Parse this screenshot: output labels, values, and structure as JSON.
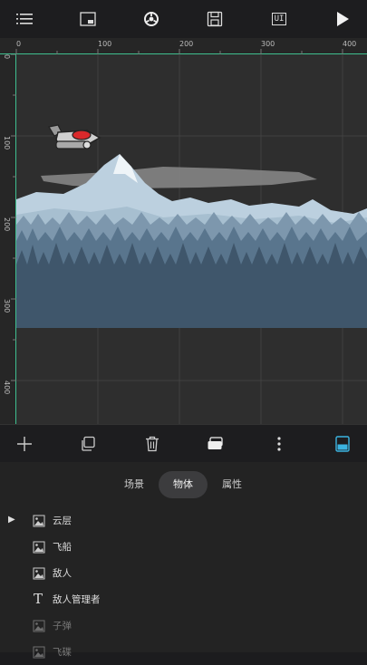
{
  "toolbar": {
    "menu_icon": "hamburger-menu",
    "layers_icon": "window",
    "settings_icon": "gear",
    "save_icon": "floppy-disk",
    "ui_label": "UI",
    "play_icon": "play"
  },
  "rulers": {
    "top_ticks": [
      "0",
      "100",
      "200",
      "300",
      "400"
    ],
    "left_ticks": [
      "0",
      "100",
      "200",
      "300",
      "400"
    ]
  },
  "edit_tools": [
    "add",
    "duplicate",
    "delete",
    "layer",
    "more",
    "panel-toggle"
  ],
  "tabs": [
    {
      "label": "场景",
      "active": false
    },
    {
      "label": "物体",
      "active": true
    },
    {
      "label": "属性",
      "active": false
    }
  ],
  "objects": [
    {
      "label": "云层",
      "type": "image",
      "expandable": true,
      "dim": false
    },
    {
      "label": "飞船",
      "type": "image",
      "expandable": false,
      "dim": false
    },
    {
      "label": "敌人",
      "type": "image",
      "expandable": false,
      "dim": false
    },
    {
      "label": "敌人管理者",
      "type": "text",
      "expandable": false,
      "dim": false
    },
    {
      "label": "子弹",
      "type": "image",
      "expandable": false,
      "dim": true
    },
    {
      "label": "飞碟",
      "type": "image",
      "expandable": false,
      "dim": true
    }
  ],
  "colors": {
    "accent_green": "#3fbf8f",
    "accent_blue": "#3bb3e0",
    "background": "#2e2e2e"
  }
}
